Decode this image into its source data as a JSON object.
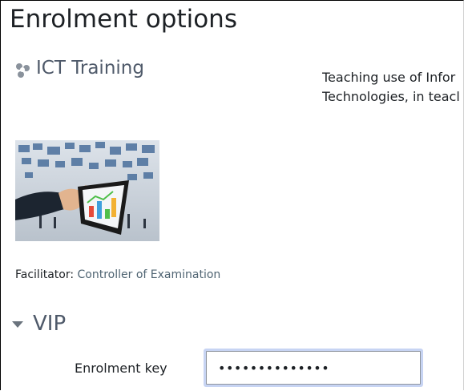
{
  "page": {
    "title": "Enrolment options"
  },
  "course": {
    "icon": "course-icon",
    "name": "ICT Training",
    "summary_line1": "Teaching use of Infor",
    "summary_line2": "Technologies, in teacl",
    "image": "course-image"
  },
  "facilitator": {
    "label": "Facilitator:",
    "name": "Controller of Examination"
  },
  "enrolment_method": {
    "toggle_icon": "caret-down-icon",
    "title": "VIP",
    "key_label": "Enrolment key",
    "key_value": "••••••••••••••",
    "accent_color": "#c7d4f3"
  }
}
